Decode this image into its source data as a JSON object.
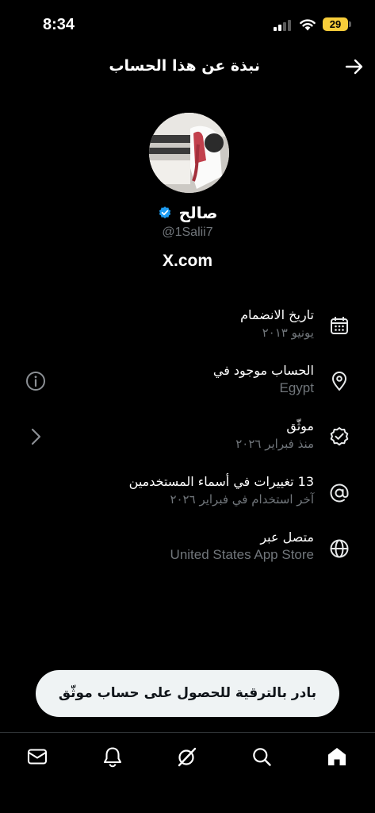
{
  "status_bar": {
    "time": "8:34",
    "battery": "29"
  },
  "header": {
    "title": "نبذة عن هذا الحساب",
    "back_icon": "arrow-right-icon"
  },
  "profile": {
    "name": "صالح",
    "handle": "@1Salii7",
    "site": "X.com",
    "verified_color": "#1d9bf0"
  },
  "rows": [
    {
      "icon": "calendar-icon",
      "title": "تاريخ الانضمام",
      "sub": "يونيو ٢٠١٣"
    },
    {
      "icon": "location-pin-icon",
      "title": "الحساب موجود في",
      "sub": "Egypt",
      "left_icon": "info-icon"
    },
    {
      "icon": "verified-check-icon",
      "title": "موثّق",
      "sub": "منذ فبراير ٢٠٢٦",
      "left_icon": "chevron-right-icon"
    },
    {
      "icon": "at-sign-icon",
      "title": "13 تغييرات في أسماء المستخدمين",
      "sub": "آخر استخدام في فبراير ٢٠٢٦"
    },
    {
      "icon": "globe-icon",
      "title": "متصل عبر",
      "sub": "United States App Store"
    }
  ],
  "upgrade": {
    "label": "بادر بالترقية للحصول على حساب موثّق"
  },
  "tabs": [
    "home-icon",
    "search-icon",
    "grok-icon",
    "notifications-bell-icon",
    "messages-envelope-icon"
  ],
  "colors": {
    "background": "#000000",
    "muted": "#71767b",
    "accent": "#1d9bf0",
    "battery": "#f7cd3a"
  }
}
